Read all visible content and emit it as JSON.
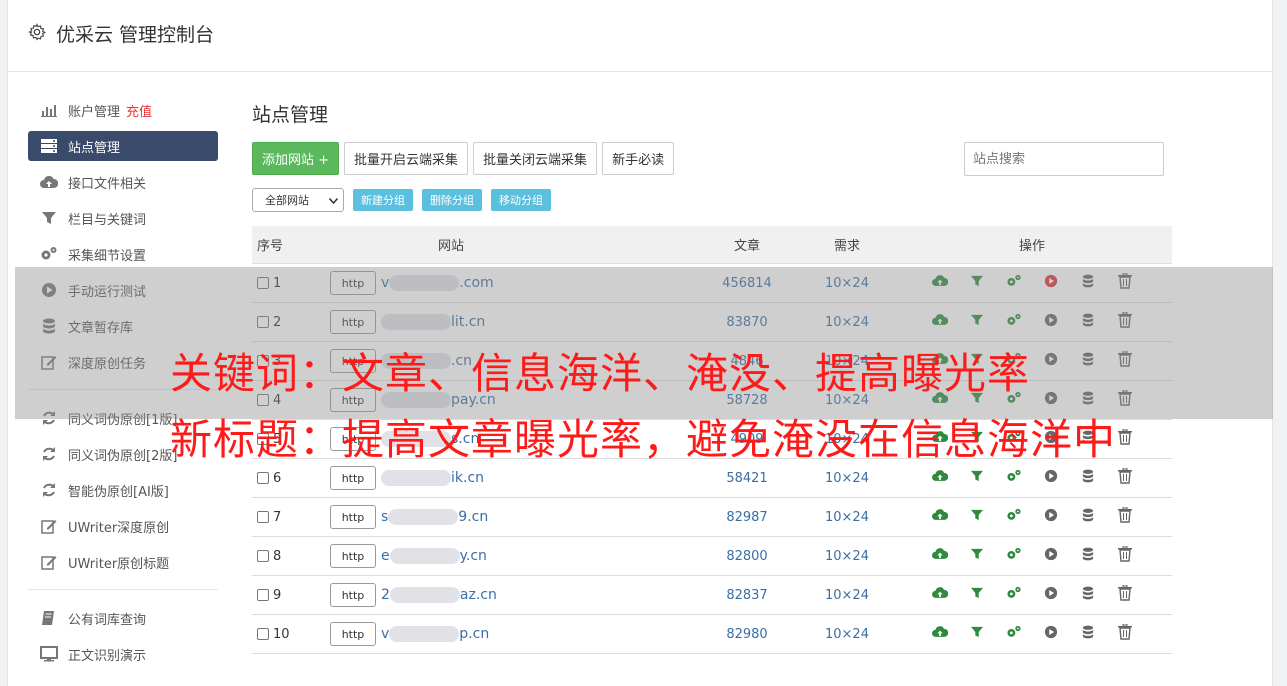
{
  "header": {
    "title": "优采云 管理控制台",
    "icon": "gear-icon"
  },
  "sidebar": {
    "items": [
      {
        "label": "账户管理",
        "badge": "充值",
        "icon": "bar-chart-icon"
      },
      {
        "label": "站点管理",
        "icon": "server-icon",
        "active": true
      },
      {
        "label": "接口文件相关",
        "icon": "cloud-upload-icon"
      },
      {
        "label": "栏目与关键词",
        "icon": "filter-icon"
      },
      {
        "label": "采集细节设置",
        "icon": "cogs-icon"
      },
      {
        "label": "手动运行测试",
        "icon": "play-icon"
      },
      {
        "label": "文章暂存库",
        "icon": "database-icon"
      },
      {
        "label": "深度原创任务",
        "icon": "edit-icon"
      }
    ],
    "items2": [
      {
        "label": "同义词伪原创[1版]",
        "icon": "refresh-icon"
      },
      {
        "label": "同义词伪原创[2版]",
        "icon": "refresh-icon"
      },
      {
        "label": "智能伪原创[AI版]",
        "icon": "refresh-icon"
      },
      {
        "label": "UWriter深度原创",
        "icon": "edit-icon"
      },
      {
        "label": "UWriter原创标题",
        "icon": "edit-icon"
      }
    ],
    "items3": [
      {
        "label": "公有词库查询",
        "icon": "book-icon"
      },
      {
        "label": "正文识别演示",
        "icon": "monitor-icon"
      }
    ]
  },
  "main": {
    "title": "站点管理",
    "buttons": {
      "add": "添加网站 +",
      "batch_open": "批量开启云端采集",
      "batch_close": "批量关闭云端采集",
      "guide": "新手必读"
    },
    "search_placeholder": "站点搜索",
    "select_value": "全部网站",
    "group_buttons": {
      "new": "新建分组",
      "delete": "删除分组",
      "move": "移动分组"
    },
    "table": {
      "headers": {
        "no": "序号",
        "site": "网站",
        "articles": "文章",
        "demand": "需求",
        "ops": "操作"
      },
      "rows": [
        {
          "no": "1",
          "proto": "http",
          "prefix": "v",
          "suffix": ".com",
          "articles": "456814",
          "demand": "10×24"
        },
        {
          "no": "2",
          "proto": "http",
          "prefix": "",
          "suffix": "lit.cn",
          "articles": "83870",
          "demand": "10×24"
        },
        {
          "no": "3",
          "proto": "http",
          "prefix": "",
          "suffix": ".cn",
          "articles": "4846",
          "demand": "10×24"
        },
        {
          "no": "4",
          "proto": "http",
          "prefix": "",
          "suffix": "pay.cn",
          "articles": "58728",
          "demand": "10×24"
        },
        {
          "no": "5",
          "proto": "http",
          "prefix": "",
          "suffix": "s.cn",
          "articles": "4909",
          "demand": "10×24"
        },
        {
          "no": "6",
          "proto": "http",
          "prefix": "",
          "suffix": "ik.cn",
          "articles": "58421",
          "demand": "10×24"
        },
        {
          "no": "7",
          "proto": "http",
          "prefix": "s",
          "suffix": "9.cn",
          "articles": "82987",
          "demand": "10×24"
        },
        {
          "no": "8",
          "proto": "http",
          "prefix": "e",
          "suffix": "y.cn",
          "articles": "82800",
          "demand": "10×24"
        },
        {
          "no": "9",
          "proto": "http",
          "prefix": "2",
          "suffix": "az.cn",
          "articles": "82837",
          "demand": "10×24"
        },
        {
          "no": "10",
          "proto": "http",
          "prefix": "v",
          "suffix": "p.cn",
          "articles": "82980",
          "demand": "10×24"
        }
      ],
      "ops_icons": [
        "cloud-upload-icon",
        "filter-icon",
        "cogs-icon",
        "play-icon",
        "database-icon",
        "trash-icon"
      ]
    }
  },
  "overlay": {
    "line1": "关键词：文章、信息海洋、淹没、提高曝光率",
    "line2": "新标题：提高文章曝光率，避免淹没在信息海洋中"
  },
  "colors": {
    "active_nav": "#3a4a6b",
    "green": "#5cb85c",
    "info": "#5bc0de",
    "link": "#3a6ea5",
    "overlay_text": "#ff1a1a"
  }
}
